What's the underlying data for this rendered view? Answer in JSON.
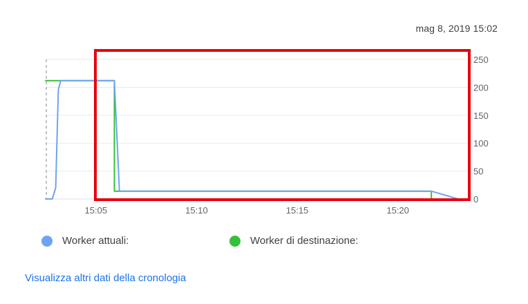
{
  "timestamp": "mag 8, 2019 15:02",
  "colors": {
    "actual": "#6ea3f0",
    "target": "#34c03a",
    "highlight": "#e8000b",
    "grid": "#e8eaed",
    "axis": "#9aa0a6"
  },
  "chart_data": {
    "type": "line",
    "x_unit": "time (HH:MM, mag 8 2019)",
    "xticks": [
      "15:05",
      "15:10",
      "15:15",
      "15:20"
    ],
    "yticks": [
      0,
      50,
      100,
      150,
      200,
      250
    ],
    "ylim": [
      0,
      250
    ],
    "xlim": [
      "15:02:30",
      "15:23:00"
    ],
    "y_axis_side": "right",
    "grid": true,
    "legend_position": "bottom",
    "series": [
      {
        "name": "Worker attuali:",
        "color_key": "actual",
        "points": [
          [
            "15:02:30",
            0
          ],
          [
            "15:02:50",
            0
          ],
          [
            "15:03:00",
            20
          ],
          [
            "15:03:08",
            195
          ],
          [
            "15:03:15",
            212
          ],
          [
            "15:05:55",
            212
          ],
          [
            "15:06:10",
            14
          ],
          [
            "15:21:40",
            14
          ],
          [
            "15:23:00",
            0
          ]
        ]
      },
      {
        "name": "Worker di destinazione:",
        "color_key": "target",
        "points": [
          [
            "15:02:30",
            212
          ],
          [
            "15:05:55",
            212
          ],
          [
            "15:05:55",
            14
          ],
          [
            "15:21:40",
            14
          ],
          [
            "15:21:40",
            0
          ]
        ]
      }
    ]
  },
  "legend": {
    "actual_label": "Worker attuali:",
    "target_label": "Worker di destinazione:"
  },
  "history_link": "Visualizza altri dati della cronologia"
}
